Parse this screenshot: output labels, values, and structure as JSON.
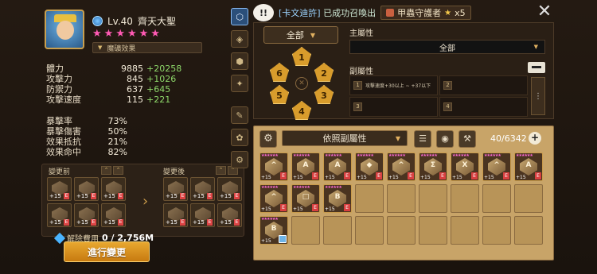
{
  "hero": {
    "level": "Lv.40",
    "name": "齊天大聖",
    "stars": 6,
    "rune_effect_label": "魔礦效果"
  },
  "stats": [
    {
      "name": "體力",
      "value": "9885",
      "bonus": "+20258"
    },
    {
      "name": "攻擊力",
      "value": "845",
      "bonus": "+1026"
    },
    {
      "name": "防禦力",
      "value": "637",
      "bonus": "+645"
    },
    {
      "name": "攻擊速度",
      "value": "115",
      "bonus": "+221"
    }
  ],
  "stats2": [
    {
      "name": "暴擊率",
      "value": "73%"
    },
    {
      "name": "暴擊傷害",
      "value": "50%"
    },
    {
      "name": "效果抵抗",
      "value": "21%"
    },
    {
      "name": "效果命中",
      "value": "82%"
    }
  ],
  "change": {
    "before_label": "變更前",
    "after_label": "變更後",
    "cost_label": "解除費用",
    "cost_value": "0 / 2,756M",
    "confirm_label": "進行變更"
  },
  "notice": {
    "prefix": "[卡文迪許]",
    "text": "已成功召喚出"
  },
  "monster_tag": {
    "name": "甲蟲守護者",
    "count": "x5"
  },
  "filter": {
    "slot_select": "全部",
    "main_attr_label": "主屬性",
    "main_attr_value": "全部",
    "sub_attr_label": "副屬性",
    "slots": [
      "1",
      "2",
      "3",
      "4",
      "5",
      "6"
    ],
    "sub_cells": [
      {
        "n": "1",
        "text": "攻擊速度+30以上 ~ +37以下"
      },
      {
        "n": "2",
        "text": ""
      },
      {
        "n": "3",
        "text": ""
      },
      {
        "n": "4",
        "text": ""
      }
    ]
  },
  "list": {
    "sort_label": "依照副屬性",
    "count": "40/6342",
    "runes": [
      {
        "g": "^",
        "lv": "+15",
        "mark": "E",
        "filled": true
      },
      {
        "g": "A",
        "lv": "+15",
        "mark": "E",
        "filled": true
      },
      {
        "g": "A",
        "lv": "+15",
        "mark": "E",
        "filled": true
      },
      {
        "g": "◆",
        "lv": "+15",
        "mark": "E",
        "filled": true
      },
      {
        "g": "^",
        "lv": "+15",
        "mark": "E",
        "filled": true
      },
      {
        "g": "Σ",
        "lv": "+15",
        "mark": "E",
        "filled": true
      },
      {
        "g": "X",
        "lv": "+15",
        "mark": "E",
        "filled": true
      },
      {
        "g": "^",
        "lv": "+15",
        "mark": "E",
        "filled": true
      },
      {
        "g": "A",
        "lv": "+15",
        "mark": "E",
        "filled": true
      },
      {
        "g": "^",
        "lv": "+15",
        "mark": "E",
        "filled": true
      },
      {
        "g": "□",
        "lv": "+15",
        "mark": "E",
        "filled": true
      },
      {
        "g": "B",
        "lv": "+15",
        "mark": "E",
        "filled": true
      },
      {
        "g": "",
        "lv": "",
        "mark": "",
        "filled": false
      },
      {
        "g": "",
        "lv": "",
        "mark": "",
        "filled": false
      },
      {
        "g": "",
        "lv": "",
        "mark": "",
        "filled": false
      },
      {
        "g": "",
        "lv": "",
        "mark": "",
        "filled": false
      },
      {
        "g": "",
        "lv": "",
        "mark": "",
        "filled": false
      },
      {
        "g": "",
        "lv": "",
        "mark": "",
        "filled": false
      },
      {
        "g": "B",
        "lv": "+15",
        "mark": "",
        "filled": true
      },
      {
        "g": "",
        "lv": "",
        "mark": "",
        "filled": false
      },
      {
        "g": "",
        "lv": "",
        "mark": "",
        "filled": false
      },
      {
        "g": "",
        "lv": "",
        "mark": "",
        "filled": false
      },
      {
        "g": "",
        "lv": "",
        "mark": "",
        "filled": false
      },
      {
        "g": "",
        "lv": "",
        "mark": "",
        "filled": false
      },
      {
        "g": "",
        "lv": "",
        "mark": "",
        "filled": false
      },
      {
        "g": "",
        "lv": "",
        "mark": "",
        "filled": false
      },
      {
        "g": "",
        "lv": "",
        "mark": "",
        "filled": false
      }
    ]
  }
}
